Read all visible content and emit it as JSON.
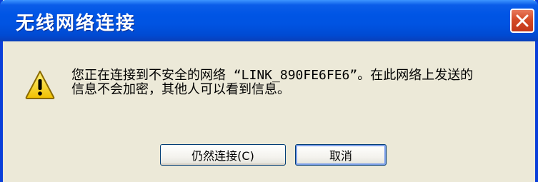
{
  "window": {
    "title": "无线网络连接",
    "close_icon": "close-icon"
  },
  "dialog": {
    "icon": "warning-icon",
    "message_line1": "您正在连接到不安全的网络 “LINK_890FE6FE6”。在此网络上发送的",
    "message_line2": "信息不会加密，其他人可以看到信息。"
  },
  "buttons": {
    "connect_label": "仍然连接(C)",
    "cancel_label": "取消"
  },
  "colors": {
    "titlebar": "#0055e5",
    "window_bg": "#ece9d8",
    "close_button": "#d44a27",
    "warning_fill": "#f5d012"
  }
}
